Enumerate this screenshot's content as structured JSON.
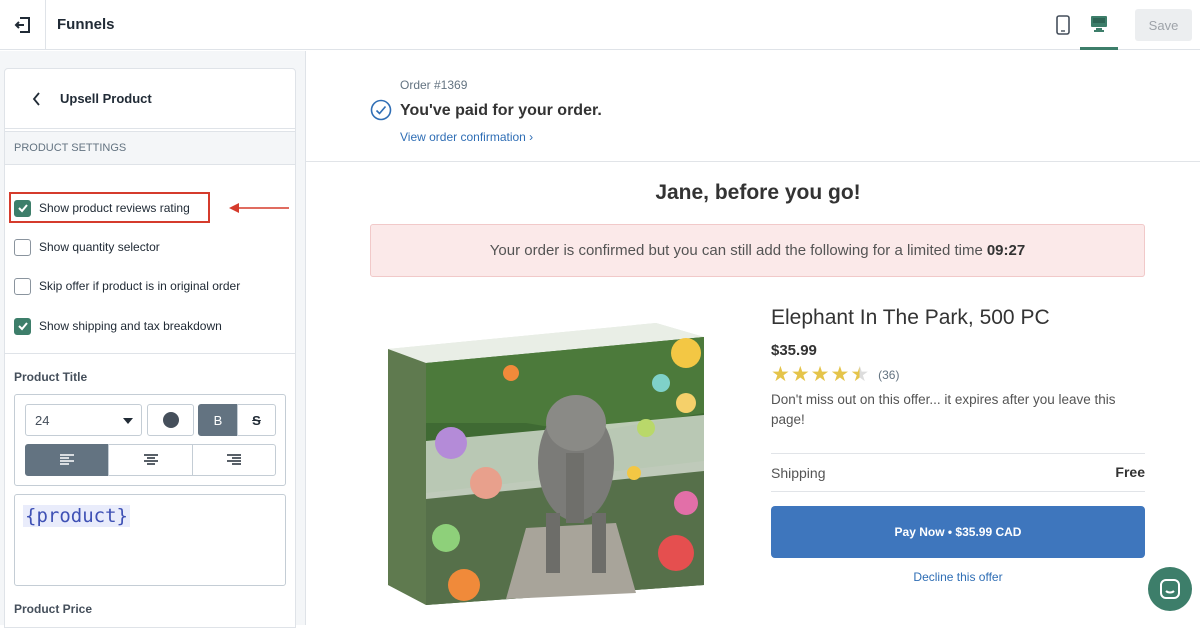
{
  "app": {
    "title": "Funnels",
    "save_label": "Save"
  },
  "sidebar": {
    "panel_title": "Upsell Product",
    "section_title": "PRODUCT SETTINGS",
    "options": [
      {
        "label": "Show product reviews rating",
        "checked": true
      },
      {
        "label": "Show quantity selector",
        "checked": false
      },
      {
        "label": "Skip offer if product is in original order",
        "checked": false
      },
      {
        "label": "Show shipping and tax breakdown",
        "checked": true
      }
    ],
    "product_title_label": "Product Title",
    "font_size": "24",
    "bold_label": "B",
    "strike_label": "S",
    "title_template": "{product}",
    "product_price_label": "Product Price"
  },
  "preview": {
    "order_number": "Order #1369",
    "paid_title": "You've paid for your order.",
    "view_link": "View order confirmation ›",
    "headline": "Jane, before you go!",
    "banner_text": "Your order is confirmed but you can still add the following for a limited time",
    "timer": "09:27",
    "product": {
      "title": "Elephant In The Park, 500 PC",
      "price": "$35.99",
      "rating": 4.5,
      "review_count": "(36)",
      "description": "Don't miss out on this offer... it expires after you leave this page!",
      "shipping_label": "Shipping",
      "shipping_value": "Free",
      "pay_button": "Pay Now • $35.99 CAD",
      "decline_link": "Decline this offer"
    }
  },
  "colors": {
    "accent_green": "#3d7e6a",
    "pay_blue": "#3e76bd",
    "link_blue": "#2f6eb5",
    "highlight_red": "#d53b2c",
    "banner_pink": "#fbe9e9",
    "star_gold": "#e5c44a"
  },
  "icons": {
    "exit": "exit-icon",
    "mobile": "mobile-device-icon",
    "desktop": "desktop-device-icon",
    "back": "chevron-left-icon",
    "paid": "check-circle-icon",
    "chat": "chat-icon"
  }
}
